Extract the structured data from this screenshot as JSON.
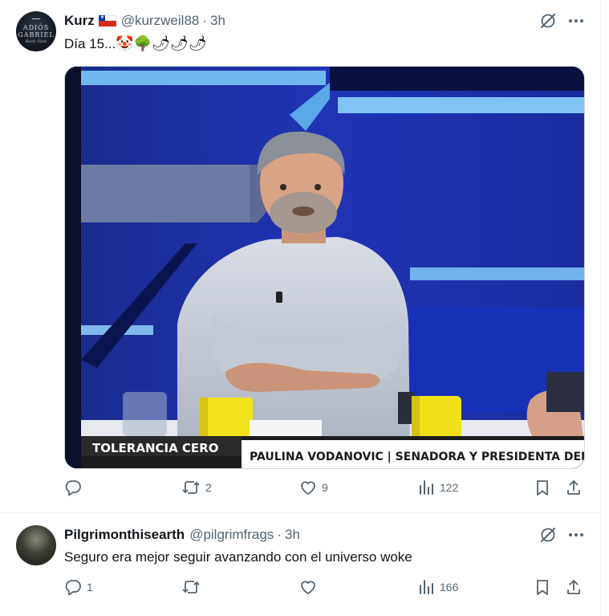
{
  "tweets": [
    {
      "author": {
        "name": "Kurz",
        "handle": "@kurzweil88",
        "time": "3h",
        "flag_icon": "chile-flag-icon",
        "avatar_text": [
          "ADIÓS",
          "GABRIEL",
          "Boric Font"
        ]
      },
      "text": "Día 15...",
      "emojis": [
        "🤡",
        "🌳",
        "🌶",
        "🌶",
        "🌶"
      ],
      "media": {
        "banner_left": "TOLERANCIA CERO",
        "banner_right": "PAULINA VODANOVIC | SENADORA Y PRESIDENTA DEL PS"
      },
      "actions": {
        "replies": "",
        "retweets": "2",
        "likes": "9",
        "views": "122"
      }
    },
    {
      "author": {
        "name": "Pilgrimonthisearth",
        "handle": "@pilgrimfrags",
        "time": "3h"
      },
      "text": "Seguro era mejor seguir avanzando con el universo woke",
      "actions": {
        "replies": "1",
        "retweets": "",
        "likes": "",
        "views": "166"
      }
    }
  ],
  "separator": "·",
  "colors": {
    "text": "#0f1419",
    "secondary": "#536471",
    "border": "#eff3f4",
    "studio_blue": "#1d34b0",
    "mug_yellow": "#f2e21c",
    "banner_bg": "#1c1c1c"
  }
}
